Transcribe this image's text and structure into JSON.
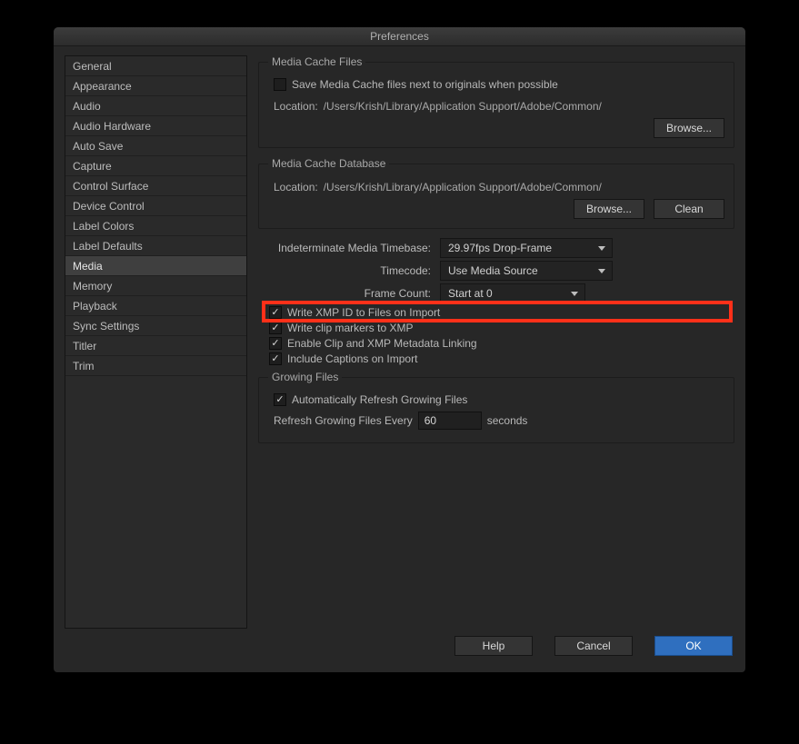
{
  "title": "Preferences",
  "sidebar": {
    "items": [
      {
        "label": "General"
      },
      {
        "label": "Appearance"
      },
      {
        "label": "Audio"
      },
      {
        "label": "Audio Hardware"
      },
      {
        "label": "Auto Save"
      },
      {
        "label": "Capture"
      },
      {
        "label": "Control Surface"
      },
      {
        "label": "Device Control"
      },
      {
        "label": "Label Colors"
      },
      {
        "label": "Label Defaults"
      },
      {
        "label": "Media",
        "selected": true
      },
      {
        "label": "Memory"
      },
      {
        "label": "Playback"
      },
      {
        "label": "Sync Settings"
      },
      {
        "label": "Titler"
      },
      {
        "label": "Trim"
      }
    ]
  },
  "mediaCacheFiles": {
    "legend": "Media Cache Files",
    "saveNext": {
      "label": "Save Media Cache files next to originals when possible",
      "checked": false
    },
    "locationLabel": "Location:",
    "locationPath": "/Users/Krish/Library/Application Support/Adobe/Common/",
    "browse": "Browse..."
  },
  "mediaCacheDb": {
    "legend": "Media Cache Database",
    "locationLabel": "Location:",
    "locationPath": "/Users/Krish/Library/Application Support/Adobe/Common/",
    "browse": "Browse...",
    "clean": "Clean"
  },
  "dropdowns": {
    "timebase": {
      "label": "Indeterminate Media Timebase:",
      "value": "29.97fps Drop-Frame"
    },
    "timecode": {
      "label": "Timecode:",
      "value": "Use Media Source"
    },
    "framecount": {
      "label": "Frame Count:",
      "value": "Start at 0"
    }
  },
  "checks": {
    "xmpId": {
      "label": "Write XMP ID to Files on Import",
      "checked": true
    },
    "clipMarkers": {
      "label": "Write clip markers to XMP",
      "checked": true
    },
    "metaLink": {
      "label": "Enable Clip and XMP Metadata Linking",
      "checked": true
    },
    "captions": {
      "label": "Include Captions on Import",
      "checked": true
    }
  },
  "growing": {
    "legend": "Growing Files",
    "auto": {
      "label": "Automatically Refresh Growing Files",
      "checked": true
    },
    "everyLabel": "Refresh Growing Files Every",
    "value": "60",
    "unit": "seconds"
  },
  "footer": {
    "help": "Help",
    "cancel": "Cancel",
    "ok": "OK"
  }
}
